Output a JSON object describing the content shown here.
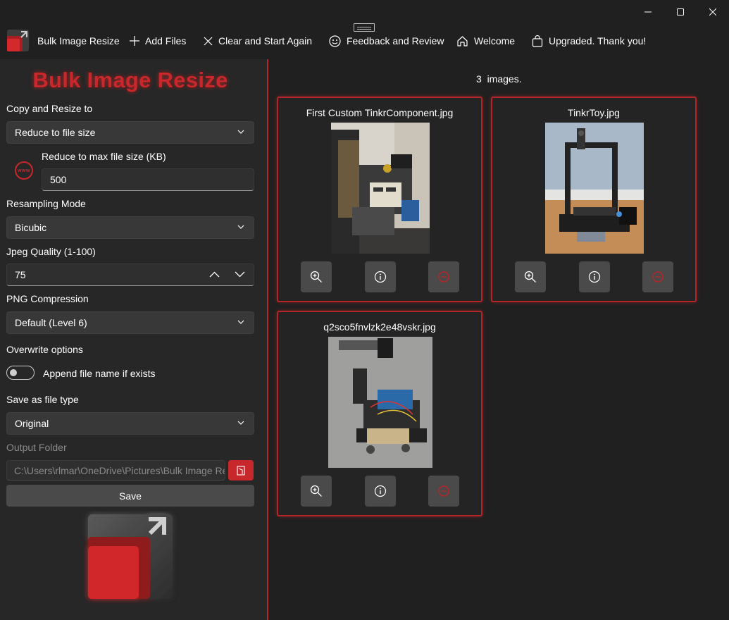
{
  "window": {
    "controls": [
      "minimize-icon",
      "maximize-icon",
      "close-icon"
    ]
  },
  "menu": {
    "app_name": "Bulk Image Resize",
    "add_files": "Add Files",
    "clear": "Clear and Start Again",
    "feedback": "Feedback and Review",
    "welcome": "Welcome",
    "upgraded": "Upgraded. Thank you!"
  },
  "left": {
    "heading": "Bulk Image Resize",
    "copy_resize_label": "Copy and Resize to",
    "copy_resize_value": "Reduce to file size",
    "max_size_label": "Reduce to max file size (KB)",
    "max_size_value": "500",
    "www_icon_text": "www",
    "resampling_label": "Resampling Mode",
    "resampling_value": "Bicubic",
    "jpeg_label": "Jpeg Quality (1-100)",
    "jpeg_value": "75",
    "png_label": "PNG Compression",
    "png_value": "Default (Level 6)",
    "overwrite_label": "Overwrite options",
    "append_label": "Append file name if exists",
    "append_enabled": false,
    "filetype_label": "Save as file type",
    "filetype_value": "Original",
    "output_label": "Output Folder",
    "output_value": "C:\\Users\\rlmar\\OneDrive\\Pictures\\Bulk Image Re",
    "save_label": "Save"
  },
  "right": {
    "count_text": "3  images.",
    "cards": [
      {
        "title": "First Custom TinkrComponent.jpg"
      },
      {
        "title": "TinkrToy.jpg"
      },
      {
        "title": "q2sco5fnvlzk2e48vskr.jpg"
      }
    ]
  },
  "colors": {
    "accent": "#c8282c",
    "background": "#202020",
    "panel": "#272727",
    "control": "#383838"
  }
}
